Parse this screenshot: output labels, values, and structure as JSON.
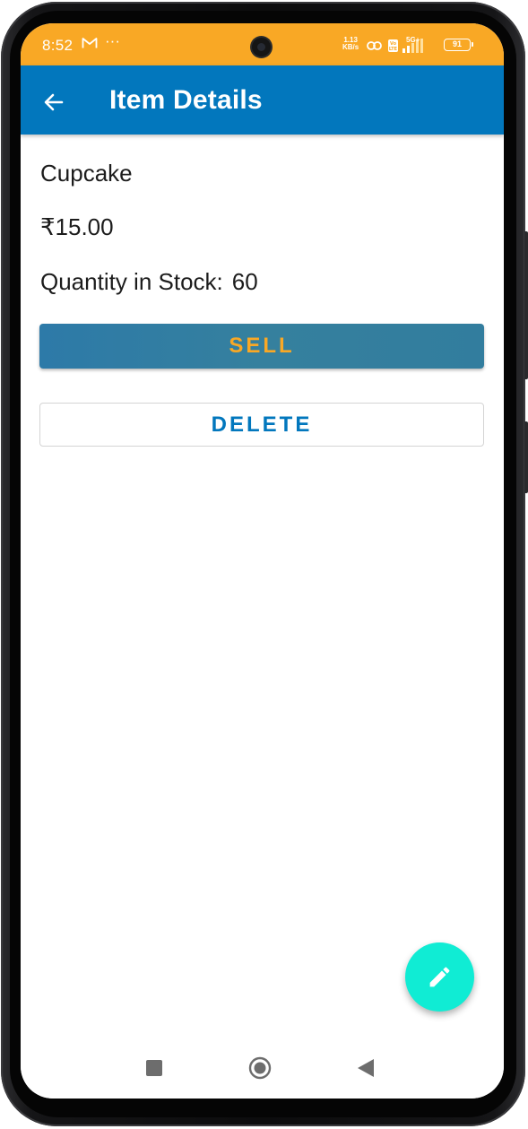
{
  "status_bar": {
    "time": "8:52",
    "mail_icon": "gmail-icon",
    "more_dots": "···",
    "net_speed_value": "1.13",
    "net_speed_unit": "KB/s",
    "network": "5G+",
    "battery": "91",
    "background_color": "#f9a825"
  },
  "app_bar": {
    "title": "Item Details",
    "back_icon": "arrow-left-icon",
    "background_color": "#0277bd"
  },
  "item": {
    "name": "Cupcake",
    "price": "₹15.00",
    "stock_label": "Quantity in Stock:",
    "stock_value": "60"
  },
  "actions": {
    "sell_label": "SELL",
    "delete_label": "DELETE",
    "edit_icon": "pencil-icon",
    "sell_text_color": "#f9a825",
    "delete_text_color": "#0277bd",
    "fab_color": "#10ecd4"
  },
  "nav_bar": {
    "recents_icon": "square-icon",
    "home_icon": "circle-icon",
    "back_icon": "triangle-back-icon"
  }
}
